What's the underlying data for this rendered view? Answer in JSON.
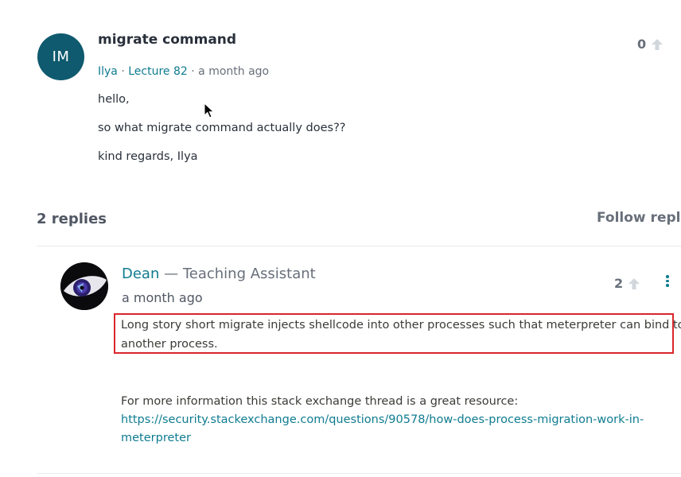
{
  "question": {
    "avatar_initials": "IM",
    "title": "migrate command",
    "author": "Ilya",
    "lecture": "Lecture 82",
    "time": "a month ago",
    "separator": "·",
    "body": [
      "hello,",
      "so what  migrate command actually does??",
      "kind regards, Ilya"
    ],
    "votes": "0"
  },
  "replies_header": {
    "count_label": "2 replies",
    "follow_label": "Follow replie"
  },
  "reply": {
    "author": "Dean",
    "role": " — Teaching Assistant",
    "time": "a month ago",
    "votes": "2",
    "text_lines": [
      "Long story short migrate injects shellcode into other processes such that meterpreter can bind to",
      "another process."
    ],
    "info_line": "For more information this stack exchange thread is a great resource:",
    "link_lines": [
      "https://security.stackexchange.com/questions/90578/how-does-process-migration-work-in-",
      "meterpreter"
    ]
  },
  "colors": {
    "avatar_bg": "#0f5a6e",
    "accent_link": "#0f7c90",
    "highlight_border": "#d9262b"
  },
  "icons": [
    "upvote-arrow-icon",
    "kebab-menu-icon",
    "mouse-cursor-icon"
  ]
}
